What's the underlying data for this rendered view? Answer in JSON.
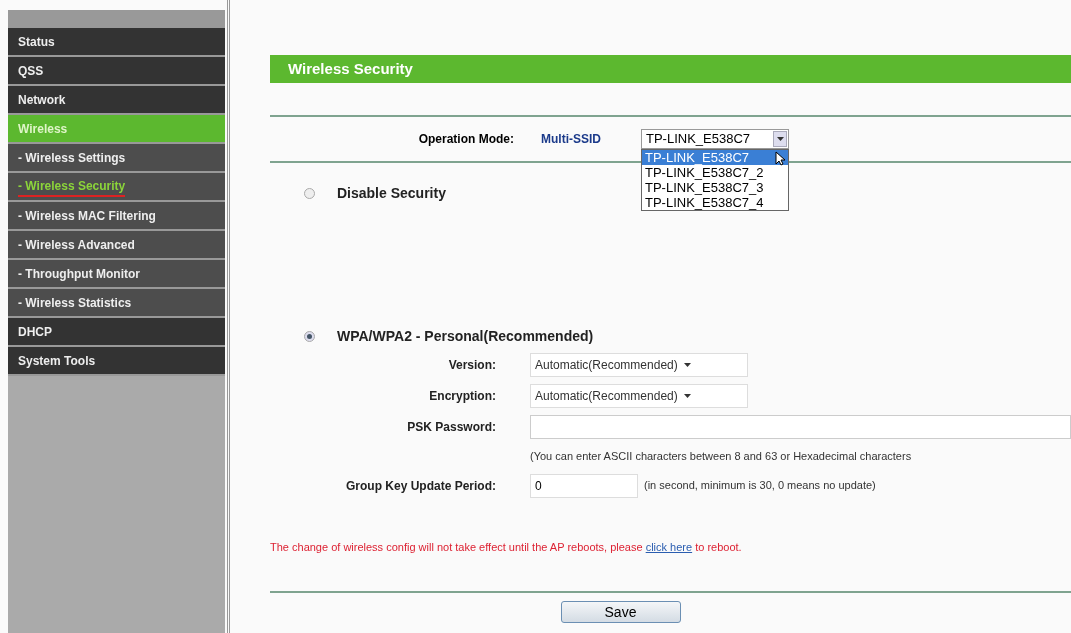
{
  "sidebar": {
    "items": [
      {
        "label": "Status",
        "selected": false
      },
      {
        "label": "QSS",
        "selected": false
      },
      {
        "label": "Network",
        "selected": false
      },
      {
        "label": "Wireless",
        "selected": true,
        "children": [
          {
            "label": "- Wireless Settings",
            "selected": false
          },
          {
            "label": "- Wireless Security",
            "selected": true
          },
          {
            "label": "- Wireless MAC Filtering",
            "selected": false
          },
          {
            "label": "- Wireless Advanced",
            "selected": false
          },
          {
            "label": "- Throughput Monitor",
            "selected": false
          },
          {
            "label": "- Wireless Statistics",
            "selected": false
          }
        ]
      },
      {
        "label": "DHCP",
        "selected": false
      },
      {
        "label": "System Tools",
        "selected": false
      }
    ]
  },
  "page_title": "Wireless Security",
  "operation_mode": {
    "label": "Operation Mode:",
    "mode": "Multi-SSID",
    "value": "TP-LINK_E538C7",
    "expanded": true,
    "options": [
      {
        "label": "TP-LINK_E538C7",
        "selected": true
      },
      {
        "label": "TP-LINK_E538C7_2",
        "selected": false
      },
      {
        "label": "TP-LINK_E538C7_3",
        "selected": false
      },
      {
        "label": "TP-LINK_E538C7_4",
        "selected": false
      }
    ]
  },
  "security_options": [
    {
      "label": "Disable Security",
      "selected": false
    },
    {
      "label": "WPA/WPA2 - Personal(Recommended)",
      "selected": true
    }
  ],
  "wpa_fields": [
    {
      "kind": "select",
      "label": "Version:",
      "value": "Automatic(Recommended)"
    },
    {
      "kind": "select",
      "label": "Encryption:",
      "value": "Automatic(Recommended)"
    },
    {
      "kind": "text",
      "label": "PSK Password:",
      "note": "(You can enter ASCII characters between 8 and 63 or Hexadecimal characters"
    },
    {
      "kind": "short",
      "label": "Group Key Update Period:",
      "value": "0",
      "hint": "(in second, minimum is 30, 0 means no update)"
    }
  ],
  "notice": {
    "before": "The change of wireless config will not take effect until the AP reboots, please",
    "link": "click here",
    "after": "to reboot."
  },
  "save_button": "Save"
}
